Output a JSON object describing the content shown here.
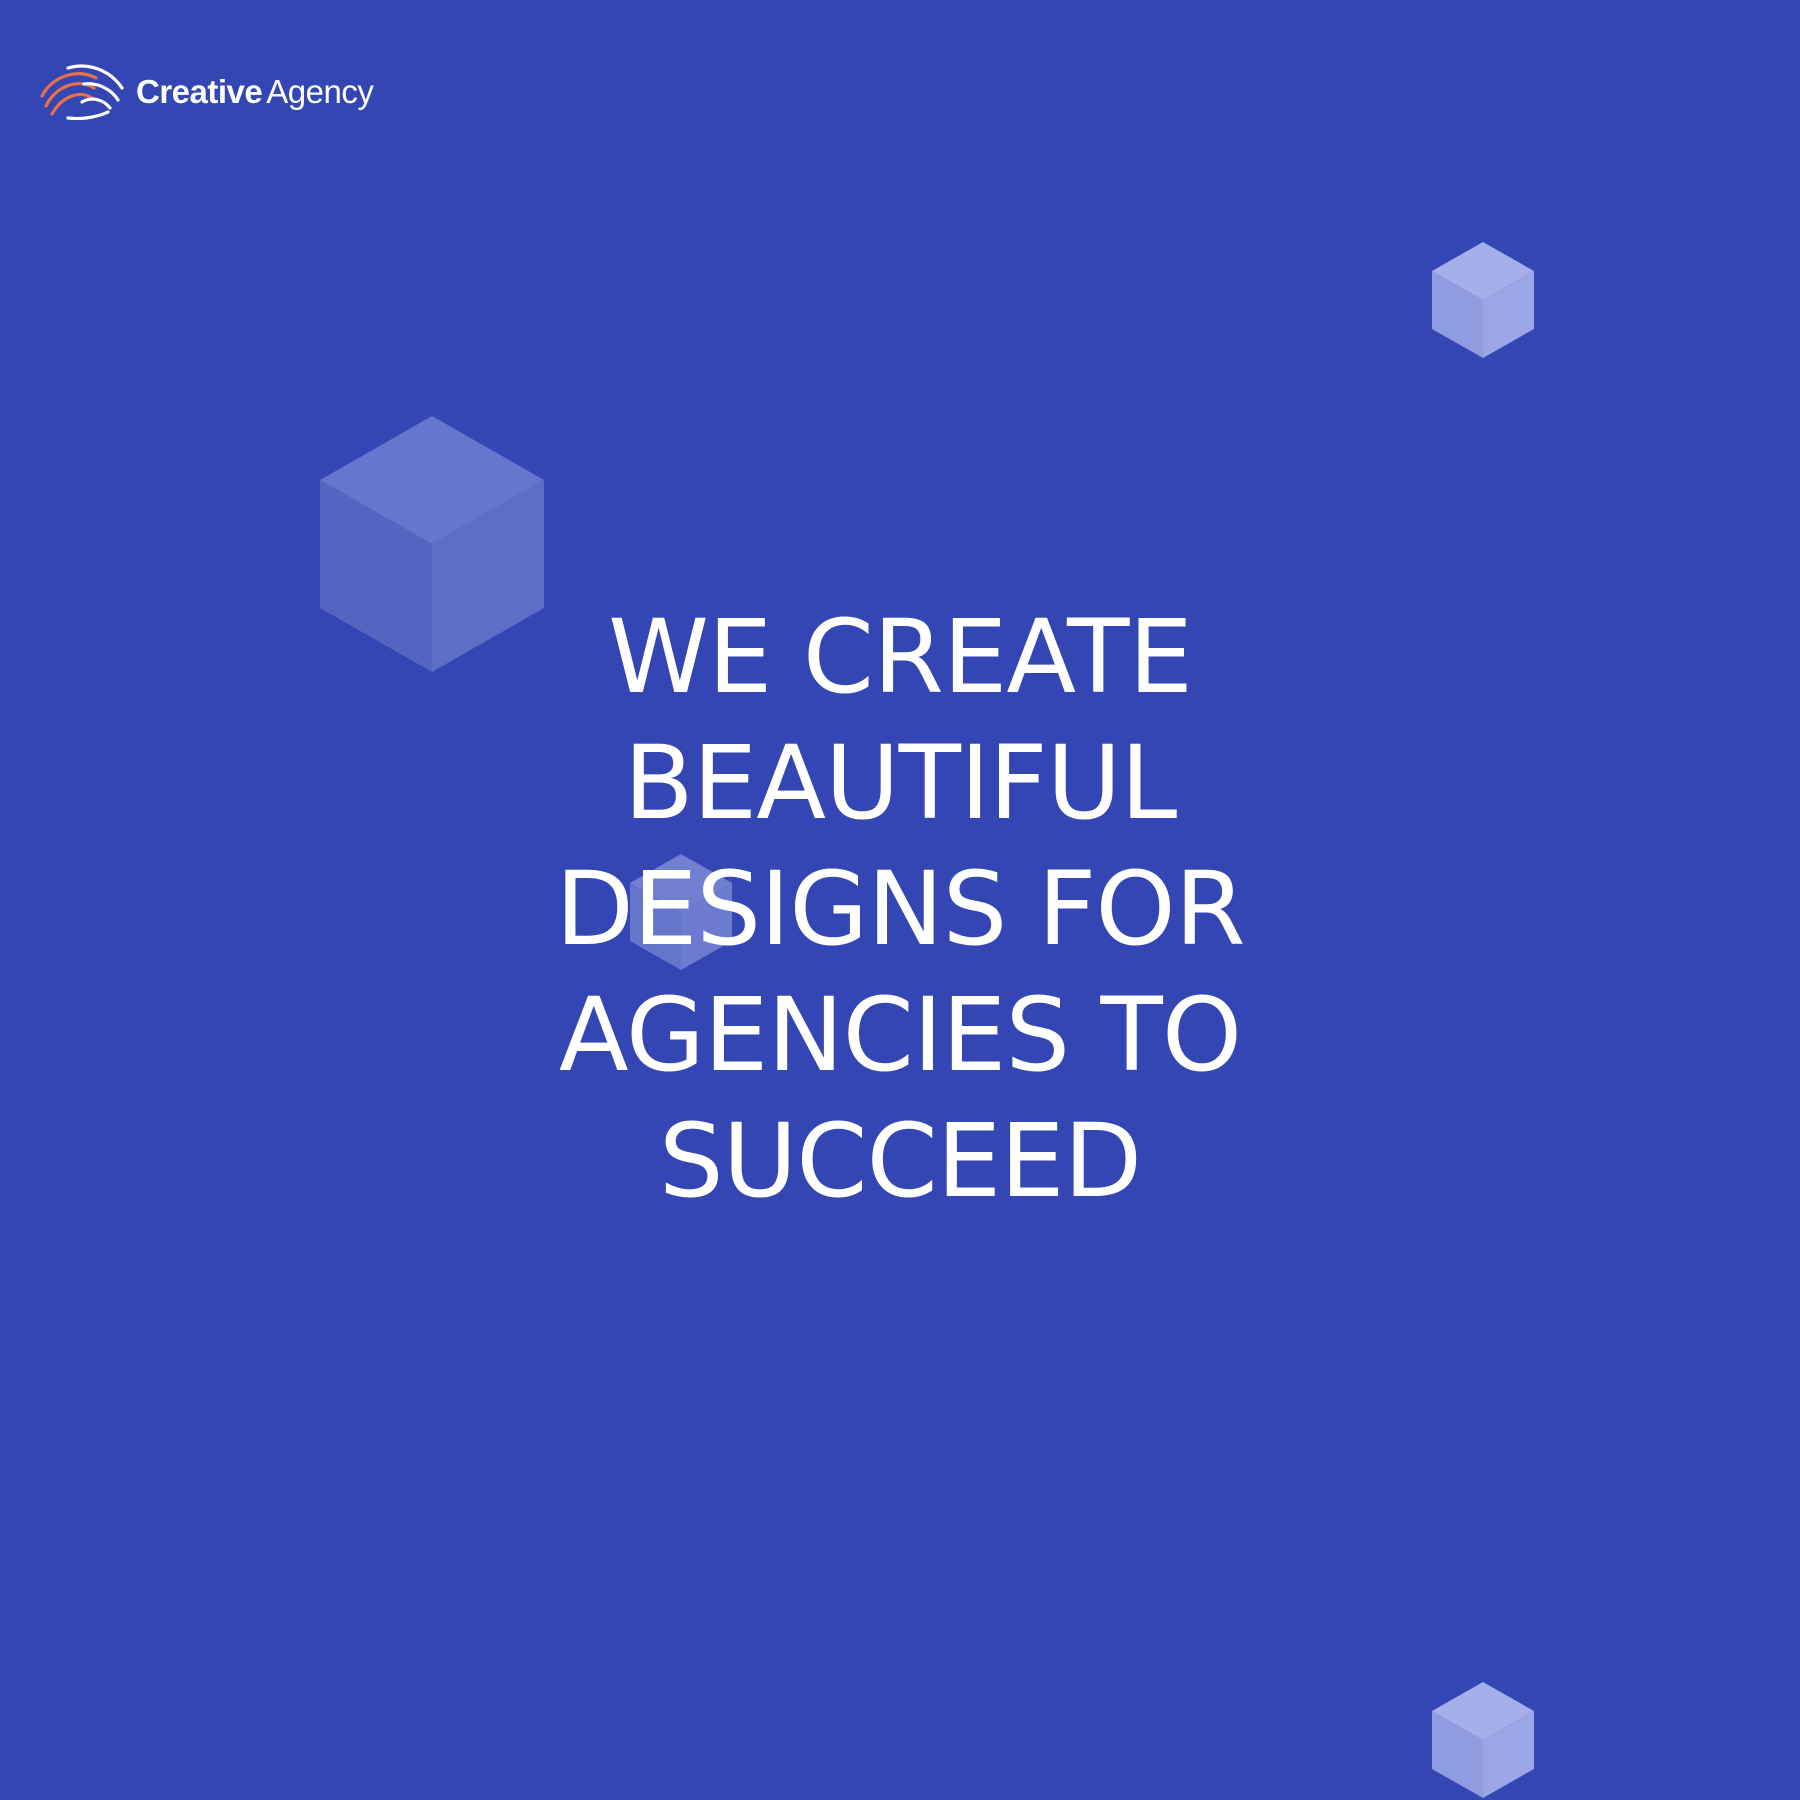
{
  "brand": {
    "name_bold": "Creative",
    "name_light": "Agency",
    "logo_icon": "fingerprint-wave-icon",
    "logo_colors": [
      "#e8704a",
      "#ffffff"
    ]
  },
  "hero": {
    "lines": [
      "WE CREATE",
      "BEAUTIFUL",
      "DESIGNS FOR",
      "AGENCIES TO",
      "SUCCEED"
    ]
  },
  "theme": {
    "background": "#3446b4",
    "text": "#ffffff",
    "cube_color": "#aab4f0"
  }
}
